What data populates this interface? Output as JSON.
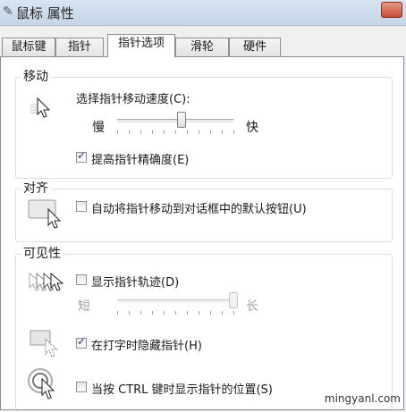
{
  "window": {
    "title": "鼠标 属性",
    "title_icon": "mouse-icon"
  },
  "tabs": [
    {
      "label": "鼠标键",
      "active": false
    },
    {
      "label": "指针",
      "active": false
    },
    {
      "label": "指针选项",
      "active": true
    },
    {
      "label": "滑轮",
      "active": false
    },
    {
      "label": "硬件",
      "active": false
    }
  ],
  "motion": {
    "group_label": "移动",
    "speed_label": "选择指针移动速度(C):",
    "slow_label": "慢",
    "fast_label": "快",
    "speed_value_fraction": 0.55,
    "precision_label": "提高指针精确度(E)",
    "precision_checked": true
  },
  "snap": {
    "group_label": "对齐",
    "snap_label": "自动将指针移动到对话框中的默认按钮(U)",
    "snap_checked": false
  },
  "visibility": {
    "group_label": "可见性",
    "trails_label": "显示指针轨迹(D)",
    "trails_checked": false,
    "short_label": "短",
    "long_label": "长",
    "trail_length_fraction": 1.0,
    "hide_label": "在打字时隐藏指针(H)",
    "hide_checked": true,
    "ctrl_label": "当按 CTRL 键时显示指针的位置(S)",
    "ctrl_checked": false
  },
  "watermark": "mingyanl.com"
}
